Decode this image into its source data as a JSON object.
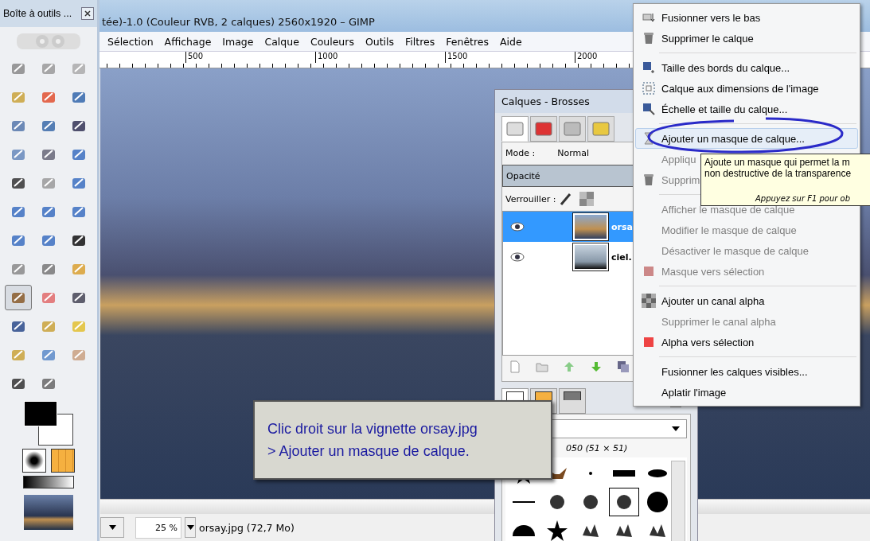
{
  "toolbox": {
    "title": "Boîte à outils ...",
    "tools": [
      {
        "selected": false
      },
      {
        "selected": false
      },
      {
        "selected": false
      },
      {
        "selected": false
      },
      {
        "selected": false
      },
      {
        "selected": false
      },
      {
        "selected": false
      },
      {
        "selected": false
      },
      {
        "selected": false
      },
      {
        "selected": false
      },
      {
        "selected": false
      },
      {
        "selected": false
      },
      {
        "selected": false
      },
      {
        "selected": false
      },
      {
        "selected": false
      },
      {
        "selected": false
      },
      {
        "selected": false
      },
      {
        "selected": false
      },
      {
        "selected": false
      },
      {
        "selected": false
      },
      {
        "selected": false
      },
      {
        "selected": false
      },
      {
        "selected": false
      },
      {
        "selected": false
      },
      {
        "selected": true
      },
      {
        "selected": false
      },
      {
        "selected": false
      },
      {
        "selected": false
      },
      {
        "selected": false
      },
      {
        "selected": false
      },
      {
        "selected": false
      },
      {
        "selected": false
      },
      {
        "selected": false
      },
      {
        "selected": false
      },
      {
        "selected": false
      }
    ]
  },
  "image_window": {
    "title": "tée)-1.0 (Couleur RVB, 2 calques) 2560x1920 – GIMP",
    "menu": [
      "Sélection",
      "Affichage",
      "Image",
      "Calque",
      "Couleurs",
      "Outils",
      "Filtres",
      "Fenêtres",
      "Aide"
    ],
    "ruler": [
      "500",
      "1000",
      "1500",
      "2000"
    ],
    "status_bar": {
      "zoom": "25 %",
      "file": "orsay.jpg (72,7 Mo)"
    }
  },
  "layers_dialog": {
    "title": "Calques - Brosses",
    "tabs": [
      {
        "selected": true
      },
      {
        "selected": false
      },
      {
        "selected": false
      },
      {
        "selected": false
      }
    ],
    "mode_label": "Mode :",
    "mode_value": "Normal",
    "opacity_label": "Opacité",
    "opacity": {
      "level": 1
    },
    "lock_label": "Verrouiller :",
    "layers": [
      {
        "name": "orsa",
        "selected": true,
        "visible": true
      },
      {
        "name": "ciel.",
        "selected": false,
        "visible": true
      }
    ],
    "brush_tabs": [
      {
        "selected": true
      },
      {
        "selected": false
      },
      {
        "selected": false
      }
    ],
    "brush_info": "050 (51 × 51)",
    "brushes": [
      {
        "selected": false
      },
      {
        "selected": false
      },
      {
        "selected": false
      },
      {
        "selected": false
      },
      {
        "selected": false
      },
      {
        "selected": false
      },
      {
        "selected": false
      },
      {
        "selected": false
      },
      {
        "selected": true
      },
      {
        "selected": false
      },
      {
        "selected": false
      },
      {
        "selected": false
      },
      {
        "selected": false
      },
      {
        "selected": false
      },
      {
        "selected": false
      }
    ]
  },
  "context_menu": [
    {
      "kind": "item",
      "label": "Fusionner vers le bas",
      "disabled": false,
      "selected": false
    },
    {
      "kind": "item",
      "label": "Supprimer le calque",
      "disabled": false,
      "selected": false
    },
    {
      "kind": "separator"
    },
    {
      "kind": "item",
      "label": "Taille des bords du calque...",
      "disabled": false,
      "selected": false
    },
    {
      "kind": "item",
      "label": "Calque aux dimensions de l'image",
      "disabled": false,
      "selected": false
    },
    {
      "kind": "item",
      "label": "Échelle et taille du calque...",
      "disabled": false,
      "selected": false
    },
    {
      "kind": "separator"
    },
    {
      "kind": "item",
      "label": "Ajouter un masque de calque...",
      "disabled": false,
      "selected": true
    },
    {
      "kind": "item",
      "label": "Appliqu",
      "disabled": true,
      "selected": false
    },
    {
      "kind": "item",
      "label": "Supprim",
      "disabled": true,
      "selected": false
    },
    {
      "kind": "separator"
    },
    {
      "kind": "item",
      "label": "Afficher le masque de calque",
      "disabled": true,
      "selected": false
    },
    {
      "kind": "item",
      "label": "Modifier le masque de calque",
      "disabled": true,
      "selected": false
    },
    {
      "kind": "item",
      "label": "Désactiver le masque de calque",
      "disabled": true,
      "selected": false
    },
    {
      "kind": "item",
      "label": "Masque vers sélection",
      "disabled": true,
      "selected": false
    },
    {
      "kind": "separator"
    },
    {
      "kind": "item",
      "label": "Ajouter un canal alpha",
      "disabled": false,
      "selected": false
    },
    {
      "kind": "item",
      "label": "Supprimer le canal alpha",
      "disabled": true,
      "selected": false
    },
    {
      "kind": "item",
      "label": "Alpha vers sélection",
      "disabled": false,
      "selected": false
    },
    {
      "kind": "separator"
    },
    {
      "kind": "item",
      "label": "Fusionner les calques visibles...",
      "disabled": false,
      "selected": false
    },
    {
      "kind": "item",
      "label": "Aplatir l'image",
      "disabled": false,
      "selected": false
    }
  ],
  "tooltip": {
    "lines": [
      "Ajoute un masque qui permet la m",
      "non destructive de la transparence"
    ],
    "hint": "Appuyez sur F1 pour ob"
  },
  "callout": {
    "lines": [
      "Clic droit sur la vignette orsay.jpg",
      "> Ajouter un masque de calque."
    ]
  }
}
